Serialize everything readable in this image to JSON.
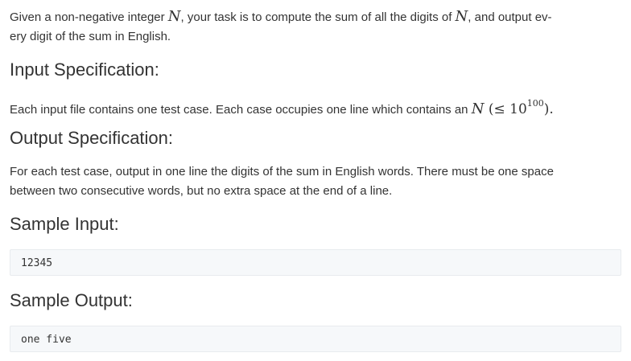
{
  "intro": {
    "t1": "Given a non-negative integer ",
    "var1": "N",
    "t2": ", your task is to compute the sum of all the digits of ",
    "var2": "N",
    "t3": ", and output ev-",
    "line2": "ery digit of the sum in English."
  },
  "input_spec": {
    "heading": "Input Specification:",
    "t1": "Each input file contains one test case. Each case occupies one line which contains an ",
    "var": "N",
    "open": " (",
    "leq": "≤",
    "base": " 10",
    "exp": "100",
    "close": ")."
  },
  "output_spec": {
    "heading": "Output Specification:",
    "line1": "For each test case, output in one line the digits of the sum in English words. There must be one space",
    "line2": "between two consecutive words, but no extra space at the end of a line."
  },
  "sample_input": {
    "heading": "Sample Input:",
    "code": "12345"
  },
  "sample_output": {
    "heading": "Sample Output:",
    "code": "one five"
  }
}
